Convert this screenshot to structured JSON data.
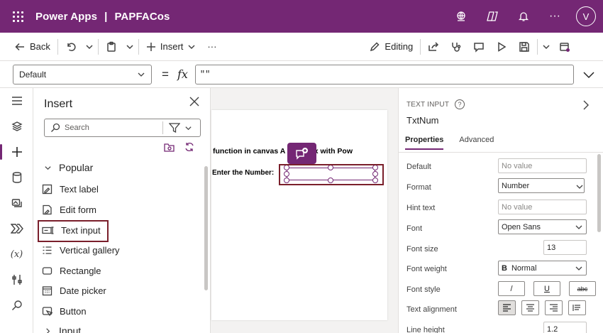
{
  "app": {
    "name": "Power Apps",
    "separator": "|",
    "project": "PAPFACos",
    "user_initial": "V"
  },
  "topbar_icons": [
    "environment-icon",
    "copilot-icon",
    "bell-icon",
    "more-icon"
  ],
  "commands": {
    "back": "Back",
    "insert": "Insert",
    "more": "···",
    "editing": "Editing"
  },
  "formula": {
    "property": "Default",
    "equals": "=",
    "fx": "fx",
    "value": "\"\""
  },
  "insert_pane": {
    "title": "Insert",
    "search_placeholder": "Search",
    "section_popular": "Popular",
    "items": [
      "Text label",
      "Edit form",
      "Text input",
      "Vertical gallery",
      "Rectangle",
      "Date picker",
      "Button"
    ],
    "section_input": "Input"
  },
  "canvas": {
    "heading": "function in canvas A     PowerFx with Pow",
    "label": "Enter the Number:"
  },
  "props_pane": {
    "control_type": "TEXT INPUT",
    "control_name": "TxtNum",
    "tabs": [
      "Properties",
      "Advanced"
    ],
    "rows": {
      "default": {
        "label": "Default",
        "value": "No value"
      },
      "format": {
        "label": "Format",
        "value": "Number"
      },
      "hint": {
        "label": "Hint text",
        "value": "No value"
      },
      "font": {
        "label": "Font",
        "value": "Open Sans"
      },
      "font_size": {
        "label": "Font size",
        "value": "13"
      },
      "font_weight": {
        "label": "Font weight",
        "value_glyph": "B",
        "value": "Normal"
      },
      "font_style": {
        "label": "Font style",
        "italic": "/",
        "underline": "U",
        "strike": "abc"
      },
      "text_alignment": {
        "label": "Text alignment"
      },
      "line_height": {
        "label": "Line height",
        "value": "1.2"
      }
    }
  },
  "colors": {
    "brand": "#742774",
    "highlight": "#7a1f2b"
  }
}
